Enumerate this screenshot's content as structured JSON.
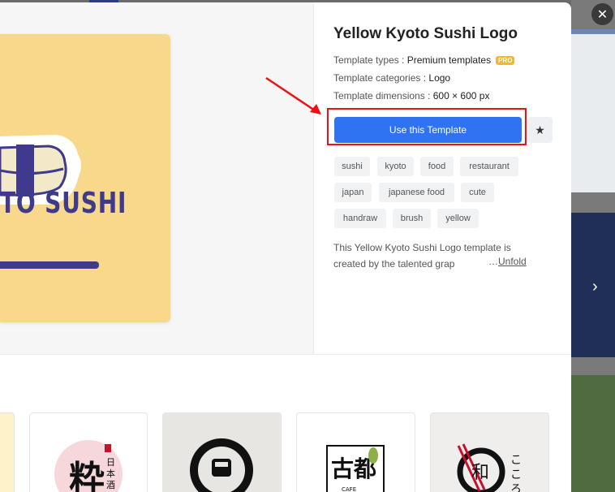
{
  "template": {
    "title": "Yellow Kyoto Sushi Logo",
    "types_label": "Template types : ",
    "types_value": "Premium templates",
    "pro_badge": "PRO",
    "categories_label": "Template categories : ",
    "categories_value": "Logo",
    "dimensions_label": "Template dimensions : ",
    "dimensions_value": "600 × 600 px",
    "use_button": "Use this Template",
    "description_line1": "This Yellow Kyoto Sushi Logo template is",
    "description_line2": "created by the talented grap",
    "unfold_prefix": "…",
    "unfold_label": "Unfold",
    "preview_text": "TO SUSHI"
  },
  "tags": [
    "sushi",
    "kyoto",
    "food",
    "restaurant",
    "japan",
    "japanese food",
    "cute",
    "handraw",
    "brush",
    "yellow"
  ],
  "icons": {
    "close": "close-icon",
    "star": "star-icon",
    "next": "chevron-right-icon"
  },
  "colors": {
    "accent": "#2f73f3",
    "highlight": "#e11111",
    "logo_bg": "#f8d98b",
    "logo_ink": "#3f3a8c",
    "pro_badge": "#f5b730"
  }
}
